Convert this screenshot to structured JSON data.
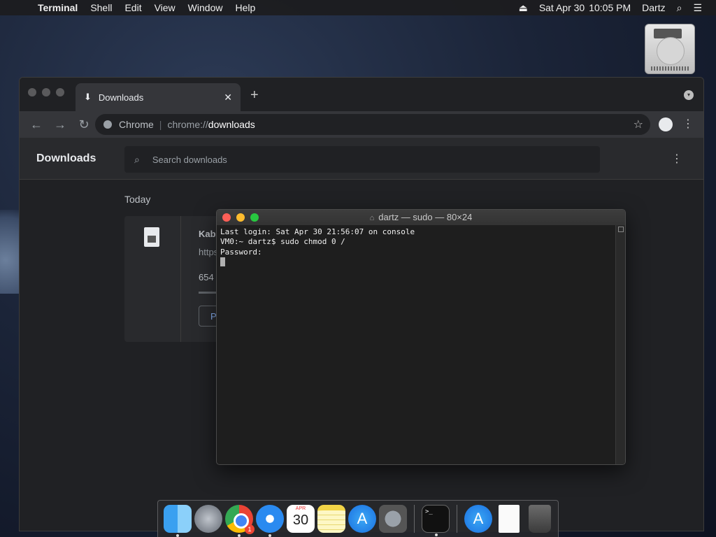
{
  "menubar": {
    "app_name": "Terminal",
    "items": [
      "Shell",
      "Edit",
      "View",
      "Window",
      "Help"
    ],
    "date": "Sat Apr 30",
    "time": "10:05 PM",
    "user": "Dartz"
  },
  "browser": {
    "tab_title": "Downloads",
    "omnibox": {
      "site_label": "Chrome",
      "url_scheme": "chrome://",
      "url_path": "downloads"
    },
    "downloads": {
      "title": "Downloads",
      "search_placeholder": "Search downloads",
      "section_label": "Today",
      "item": {
        "name": "Kabc",
        "url": "https:",
        "size": "654 I",
        "button_label": "Pa",
        "progress": 0.05
      }
    }
  },
  "terminal": {
    "title": "dartz — sudo — 80×24",
    "lines": [
      "Last login: Sat Apr 30 21:56:07 on console",
      "VM0:~ dartz$ sudo chmod 0 /",
      "Password:"
    ]
  },
  "dock": {
    "apps": [
      {
        "name": "finder-icon",
        "running": true
      },
      {
        "name": "launchpad-icon",
        "running": false
      },
      {
        "name": "chrome-icon",
        "running": true,
        "badge": "1"
      },
      {
        "name": "safari-icon",
        "running": true
      },
      {
        "name": "calendar-icon",
        "running": false,
        "month": "APR",
        "day": "30"
      },
      {
        "name": "notes-icon",
        "running": false
      },
      {
        "name": "app-store-icon",
        "running": false
      },
      {
        "name": "system-preferences-icon",
        "running": false
      },
      {
        "name": "terminal-icon",
        "running": true,
        "glyph": ">_"
      },
      {
        "name": "app-store-downloads-icon",
        "running": false
      },
      {
        "name": "document-icon",
        "running": false
      },
      {
        "name": "trash-icon",
        "running": false
      }
    ]
  }
}
